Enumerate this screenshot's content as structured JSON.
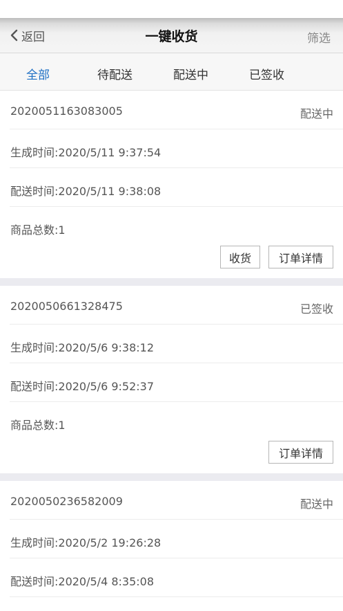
{
  "navbar": {
    "back_label": "返回",
    "title": "一键收货",
    "filter_label": "筛选"
  },
  "tabs": [
    {
      "label": "全部",
      "active": true
    },
    {
      "label": "待配送",
      "active": false
    },
    {
      "label": "配送中",
      "active": false
    },
    {
      "label": "已签收",
      "active": false
    }
  ],
  "orders": [
    {
      "order_no": "2020051163083005",
      "status": "配送中",
      "created": "生成时间:2020/5/11 9:37:54",
      "delivered": "配送时间:2020/5/11 9:38:08",
      "count": "商品总数:1",
      "receive_label": "收货",
      "detail_label": "订单详情"
    },
    {
      "order_no": "2020050661328475",
      "status": "已签收",
      "created": "生成时间:2020/5/6 9:38:12",
      "delivered": "配送时间:2020/5/6 9:52:37",
      "count": "商品总数:1",
      "detail_label": "订单详情"
    },
    {
      "order_no": "2020050236582009",
      "status": "配送中",
      "created": "生成时间:2020/5/2 19:26:28",
      "delivered": "配送时间:2020/5/4 8:35:08"
    }
  ],
  "colors": {
    "accent": "#1e6fc4",
    "separator": "#ebebf0"
  }
}
